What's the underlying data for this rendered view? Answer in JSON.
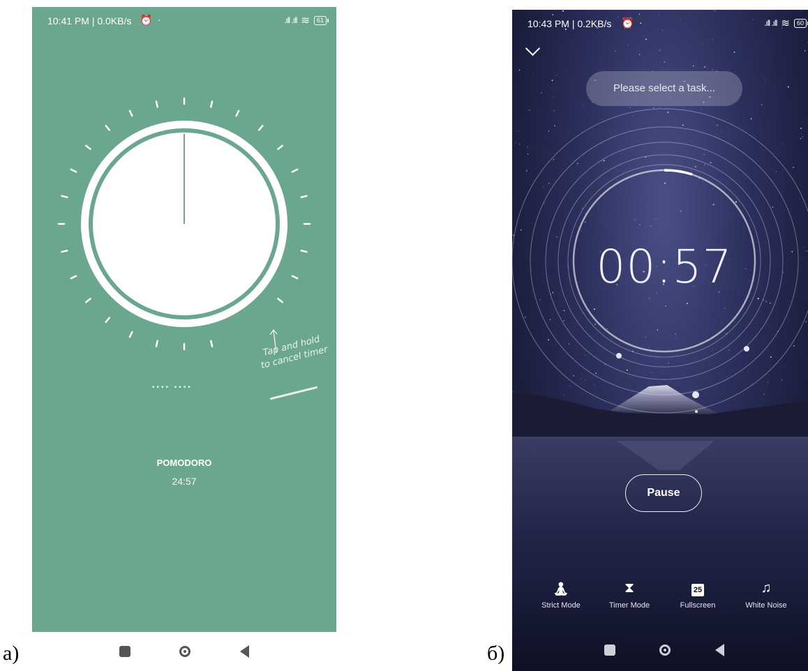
{
  "captions": {
    "left": "а)",
    "right": "б)"
  },
  "phone_a": {
    "status": {
      "time": "10:41 PM | 0.0KB/s",
      "alarm_icon": "alarm-clock-icon",
      "battery": "61"
    },
    "hint": {
      "line1": "Tap and hold",
      "line2": "to cancel timer"
    },
    "progress_dots": "•••• ••••",
    "mode_label": "POMODORO",
    "mode_time": "24:57",
    "colors": {
      "background": "#6ba68f",
      "dial": "#ffffff"
    }
  },
  "phone_b": {
    "status": {
      "time": "10:43 PM | 0.2KB/s",
      "alarm_icon": "alarm-clock-icon",
      "battery": "60"
    },
    "task_placeholder": "Please select a task...",
    "timer": "00:57",
    "pause_label": "Pause",
    "tools": [
      {
        "label": "Strict Mode",
        "icon": "meditation-icon"
      },
      {
        "label": "Timer Mode",
        "icon": "hourglass-icon"
      },
      {
        "label": "Fullscreen",
        "icon": "calendar-icon",
        "badge": "25"
      },
      {
        "label": "White Noise",
        "icon": "music-note-icon"
      }
    ]
  }
}
